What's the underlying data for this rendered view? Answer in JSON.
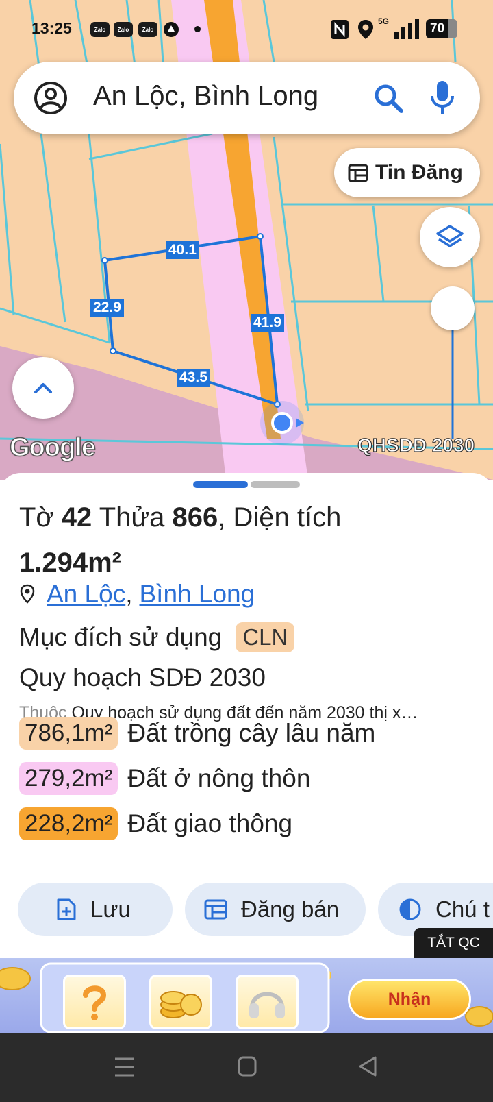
{
  "status": {
    "time": "13:25",
    "notification_apps": [
      "Zalo",
      "Zalo",
      "Zalo"
    ],
    "network": "5G",
    "battery": "70"
  },
  "search": {
    "query": "An Lộc, Bình Long"
  },
  "map": {
    "tin_dang_label": "Tin Đăng",
    "edge_labels": [
      "40.1",
      "22.9",
      "41.9",
      "43.5"
    ],
    "google_label": "Google",
    "layer_label": "QHSDĐ 2030"
  },
  "parcel": {
    "title_prefix": "Tờ",
    "sheet_no": "42",
    "title_mid": "Thửa",
    "parcel_no": "866",
    "title_suffix": ", Diện tích",
    "area": "1.294m²",
    "location_ward": "An Lộc",
    "location_sep": ",",
    "location_town": "Bình Long",
    "purpose_label": "Mục đích sử dụng",
    "purpose_code": "CLN",
    "plan_title": "Quy hoạch SDĐ 2030",
    "plan_desc_prefix": "Thuộc",
    "plan_desc": "Quy hoạch sử dụng đất đến năm 2030 thị x…",
    "land_uses": [
      {
        "area": "786,1m²",
        "label": "Đất trồng cây lâu năm",
        "color": "#f9d2a8"
      },
      {
        "area": "279,2m²",
        "label": "Đất ở nông thôn",
        "color": "#f9c9f2"
      },
      {
        "area": "228,2m²",
        "label": "Đất giao thông",
        "color": "#f7a531"
      }
    ]
  },
  "actions": {
    "save": "Lưu",
    "post_sale": "Đăng bán",
    "legend": "Chú t"
  },
  "ad": {
    "hide_label": "TẮT QC",
    "claim_label": "Nhận"
  },
  "colors": {
    "map_land": "#f9d2a8",
    "road_pink": "#f9c9f2",
    "road_orange": "#f7a531",
    "accent_blue": "#2a6fd6",
    "parcel_line": "#1e73d8"
  }
}
